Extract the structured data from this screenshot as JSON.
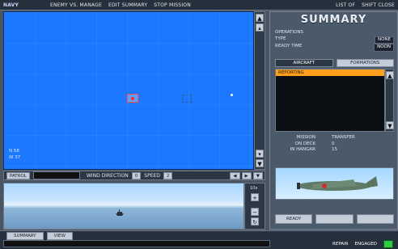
{
  "topbar": {
    "logo": "NAVY",
    "items": [
      "ENEMY VS. MANAGE",
      "EDIT SUMMARY",
      "STOP MISSION",
      "LIST OF",
      "SHIFT CLOSE"
    ]
  },
  "map": {
    "coords": {
      "lat": "N 58",
      "lon": "W 37"
    }
  },
  "controls": {
    "patrol": "PATROL",
    "wind_dir": "WIND DIRECTION",
    "wind_value": "0",
    "speed": "SPEED",
    "speed_value": "2"
  },
  "view": {
    "zoom": "10x"
  },
  "bottom": {
    "tabs": [
      "SUMMARY",
      "VIEW"
    ],
    "status_left": "REPAIR",
    "status_right": "ENGAGED"
  },
  "summary_panel": {
    "title": "SUMMARY",
    "operations_label": "OPERATIONS",
    "type_label": "TYPE",
    "type_value": "NONE",
    "ready_time_label": "READY TIME",
    "ready_time_value": "NOON",
    "tabs": [
      "AIRCRAFT",
      "FORMATIONS"
    ],
    "list": {
      "selected": "REPORTING"
    },
    "mission_label": "MISSION",
    "mission_value": "TRANSFER",
    "on_deck_label": "ON DECK",
    "on_deck_value": "0",
    "in_hangar_label": "IN HANGAR",
    "in_hangar_value": "15",
    "buttons": [
      "READY",
      "",
      ""
    ]
  },
  "colors": {
    "sea": "#1b78ff",
    "selection": "#ff9f1c",
    "ui_bg": "#4b5a6b",
    "status_ok": "#2ecc40"
  }
}
